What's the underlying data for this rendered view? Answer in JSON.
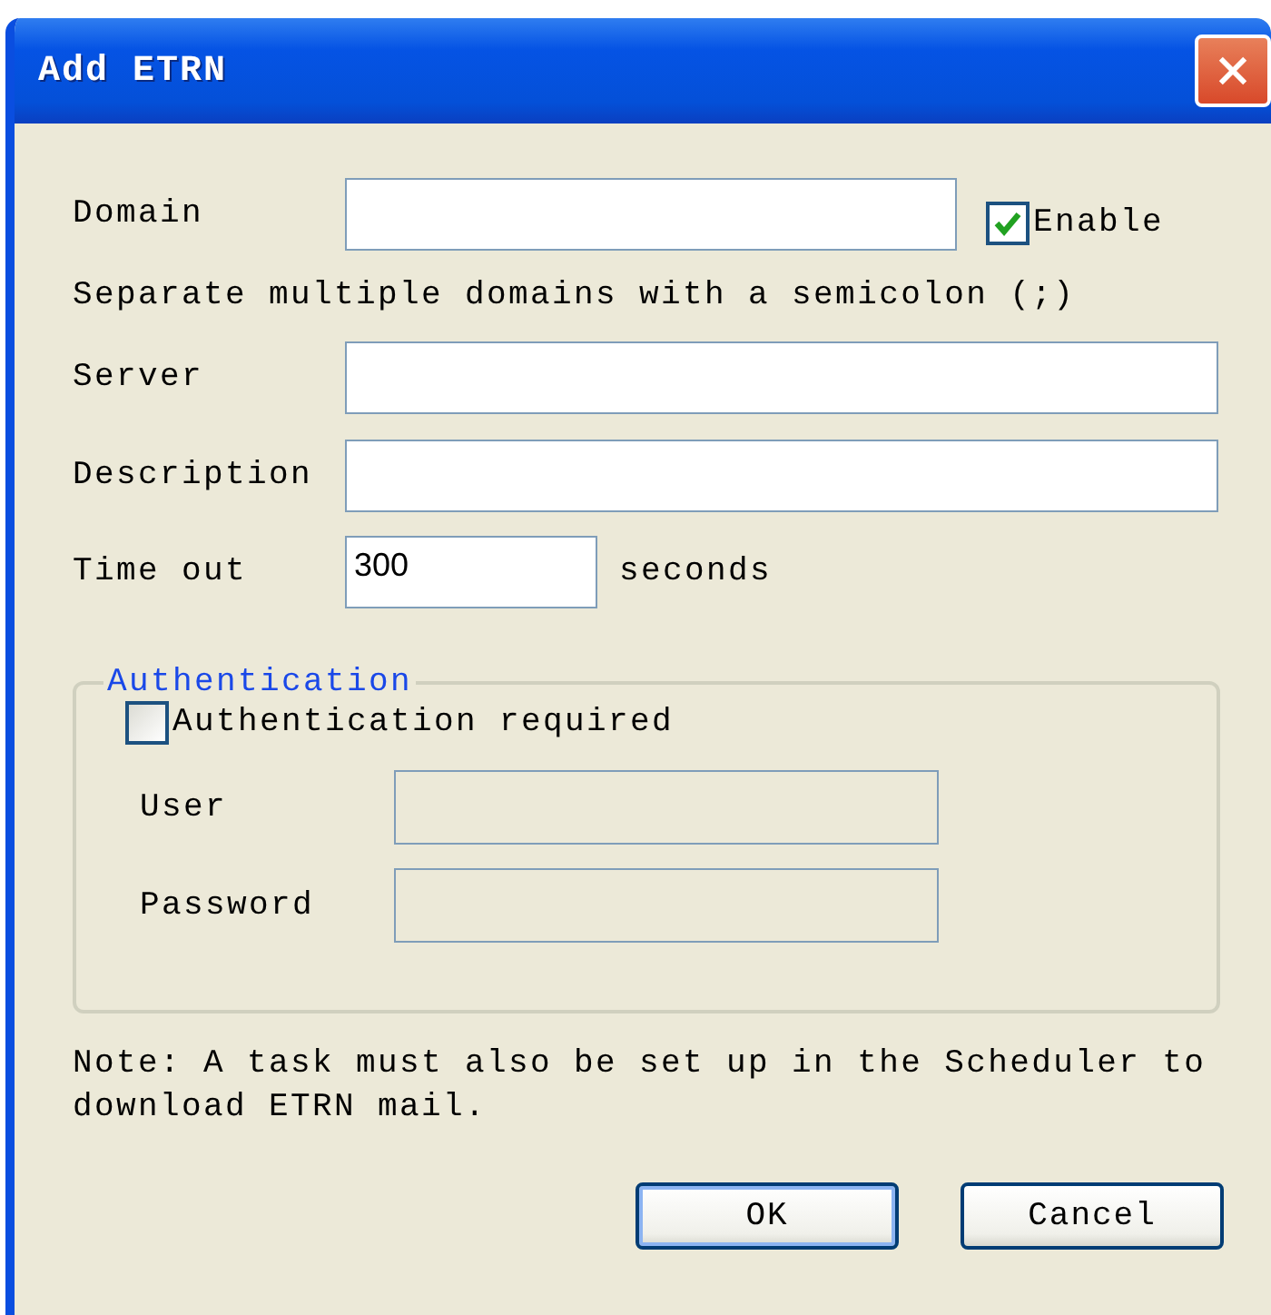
{
  "window": {
    "title": "Add ETRN"
  },
  "domain": {
    "label": "Domain"
  },
  "enable": {
    "label": "Enable",
    "checked": true
  },
  "hint": "Separate multiple domains with a semicolon (;)",
  "fields": [
    {
      "label": "Server"
    },
    {
      "label": "Description"
    }
  ],
  "timeout": {
    "label": "Time out",
    "value": "300",
    "unit": "seconds"
  },
  "authentication": {
    "title": "Authentication",
    "required": {
      "label": "Authentication required",
      "checked": false
    },
    "fields": [
      {
        "label": "User",
        "disabled": true
      },
      {
        "label": "Password",
        "disabled": true
      }
    ]
  },
  "note": "Note: A task must also be set up in the Scheduler to download ETRN mail.",
  "buttons": [
    {
      "label": "OK",
      "default": true
    },
    {
      "label": "Cancel",
      "default": false
    }
  ]
}
